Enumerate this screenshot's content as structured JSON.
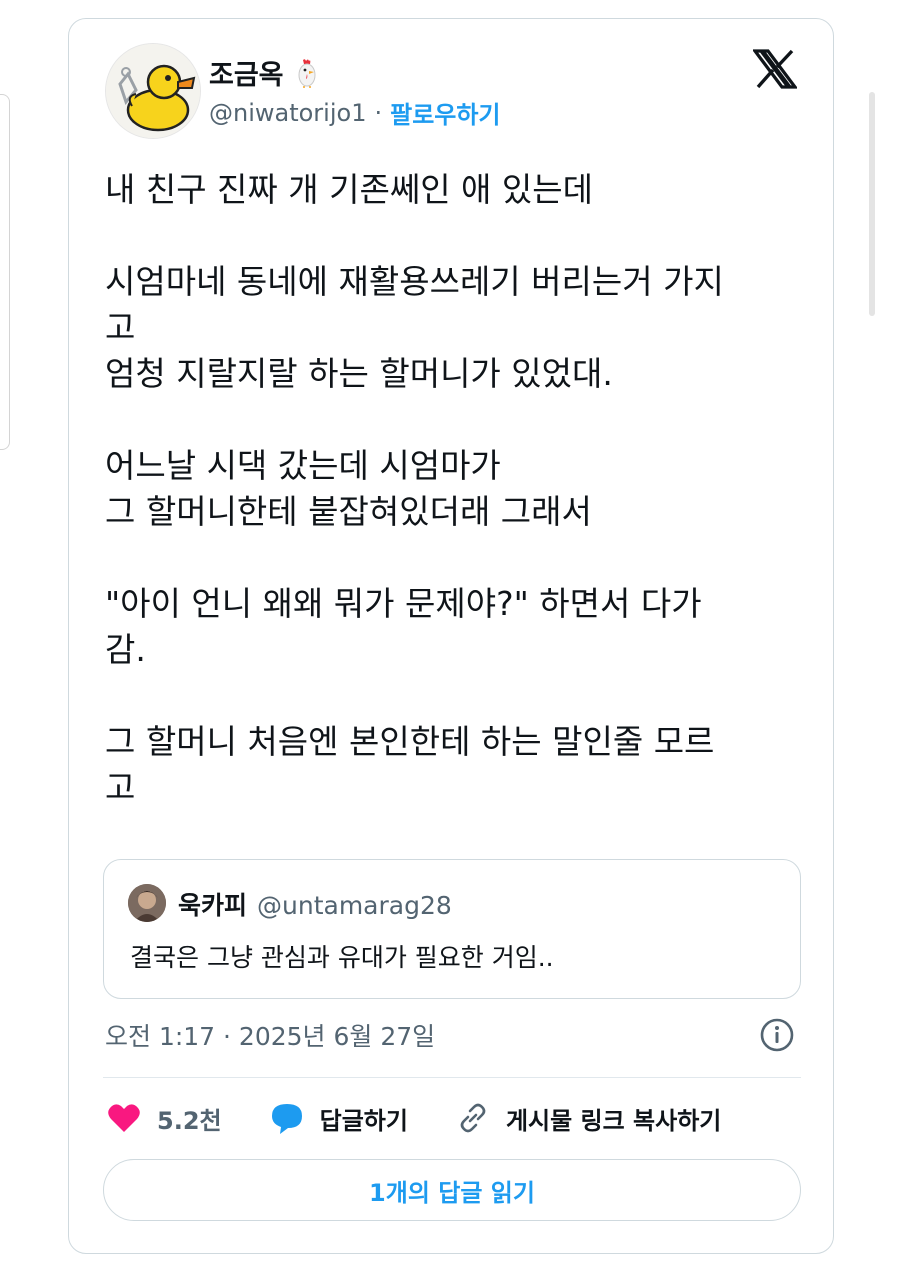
{
  "author": {
    "display_name": "조금옥",
    "handle": "@niwatorijo1",
    "separator": "·",
    "follow_label": "팔로우하기",
    "avatar_icon": "rubber-duck-avatar",
    "name_emoji_icon": "chicken-icon"
  },
  "tweet": {
    "paragraphs": [
      [
        "내 친구 진짜 개 기존쎄인 애 있는데"
      ],
      [
        "시엄마네 동네에 재활용쓰레기 버리는거 가지",
        "고",
        "엄청 지랄지랄 하는 할머니가 있었대."
      ],
      [
        "어느날 시댁 갔는데 시엄마가",
        "그 할머니한테 붙잡혀있더래 그래서"
      ],
      [
        "\"아이 언니 왜왜 뭐가 문제야?\" 하면서 다가",
        "감."
      ],
      [
        "그 할머니 처음엔 본인한테 하는 말인줄 모르",
        "고"
      ]
    ]
  },
  "quote": {
    "display_name": "욱카피",
    "handle": "@untamarag28",
    "text": "결국은 그냥 관심과 유대가 필요한 거임.."
  },
  "timestamp": "오전 1:17 · 2025년 6월 27일",
  "actions": {
    "like_count": "5.2천",
    "reply_label": "답글하기",
    "copy_link_label": "게시물 링크 복사하기"
  },
  "read_replies_label": "1개의 답글 읽기",
  "colors": {
    "accent": "#1d9bf0",
    "like": "#f91880",
    "text": "#0f1419",
    "secondary": "#536471",
    "border": "#cfd9de"
  }
}
